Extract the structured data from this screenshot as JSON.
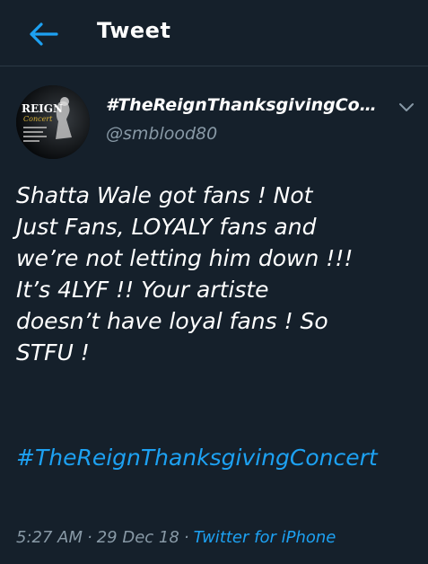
{
  "header": {
    "title": "Tweet"
  },
  "tweet": {
    "display_name": "#TheReignThanksgivingConc...",
    "handle": "@smblood80",
    "text": "Shatta Wale got fans ! Not\nJust Fans, LOYALY fans and\nwe’re not letting him down !!!\nIt’s 4LYF !! Your artiste\ndoesn’t have loyal fans ! So\nSTFU !",
    "hashtag": "#TheReignThanksgivingConcert",
    "time": "5:27 AM",
    "separator": "·",
    "date": "29 Dec 18",
    "source": "Twitter for iPhone"
  },
  "avatar": {
    "logo_text": "REIGN",
    "script_text": "Concert"
  },
  "colors": {
    "background": "#15202b",
    "accent": "#1da1f2",
    "secondary_text": "#8899a6",
    "divider": "#2b3945"
  },
  "icons": {
    "back": "arrow-left-icon",
    "menu": "chevron-down-icon"
  }
}
